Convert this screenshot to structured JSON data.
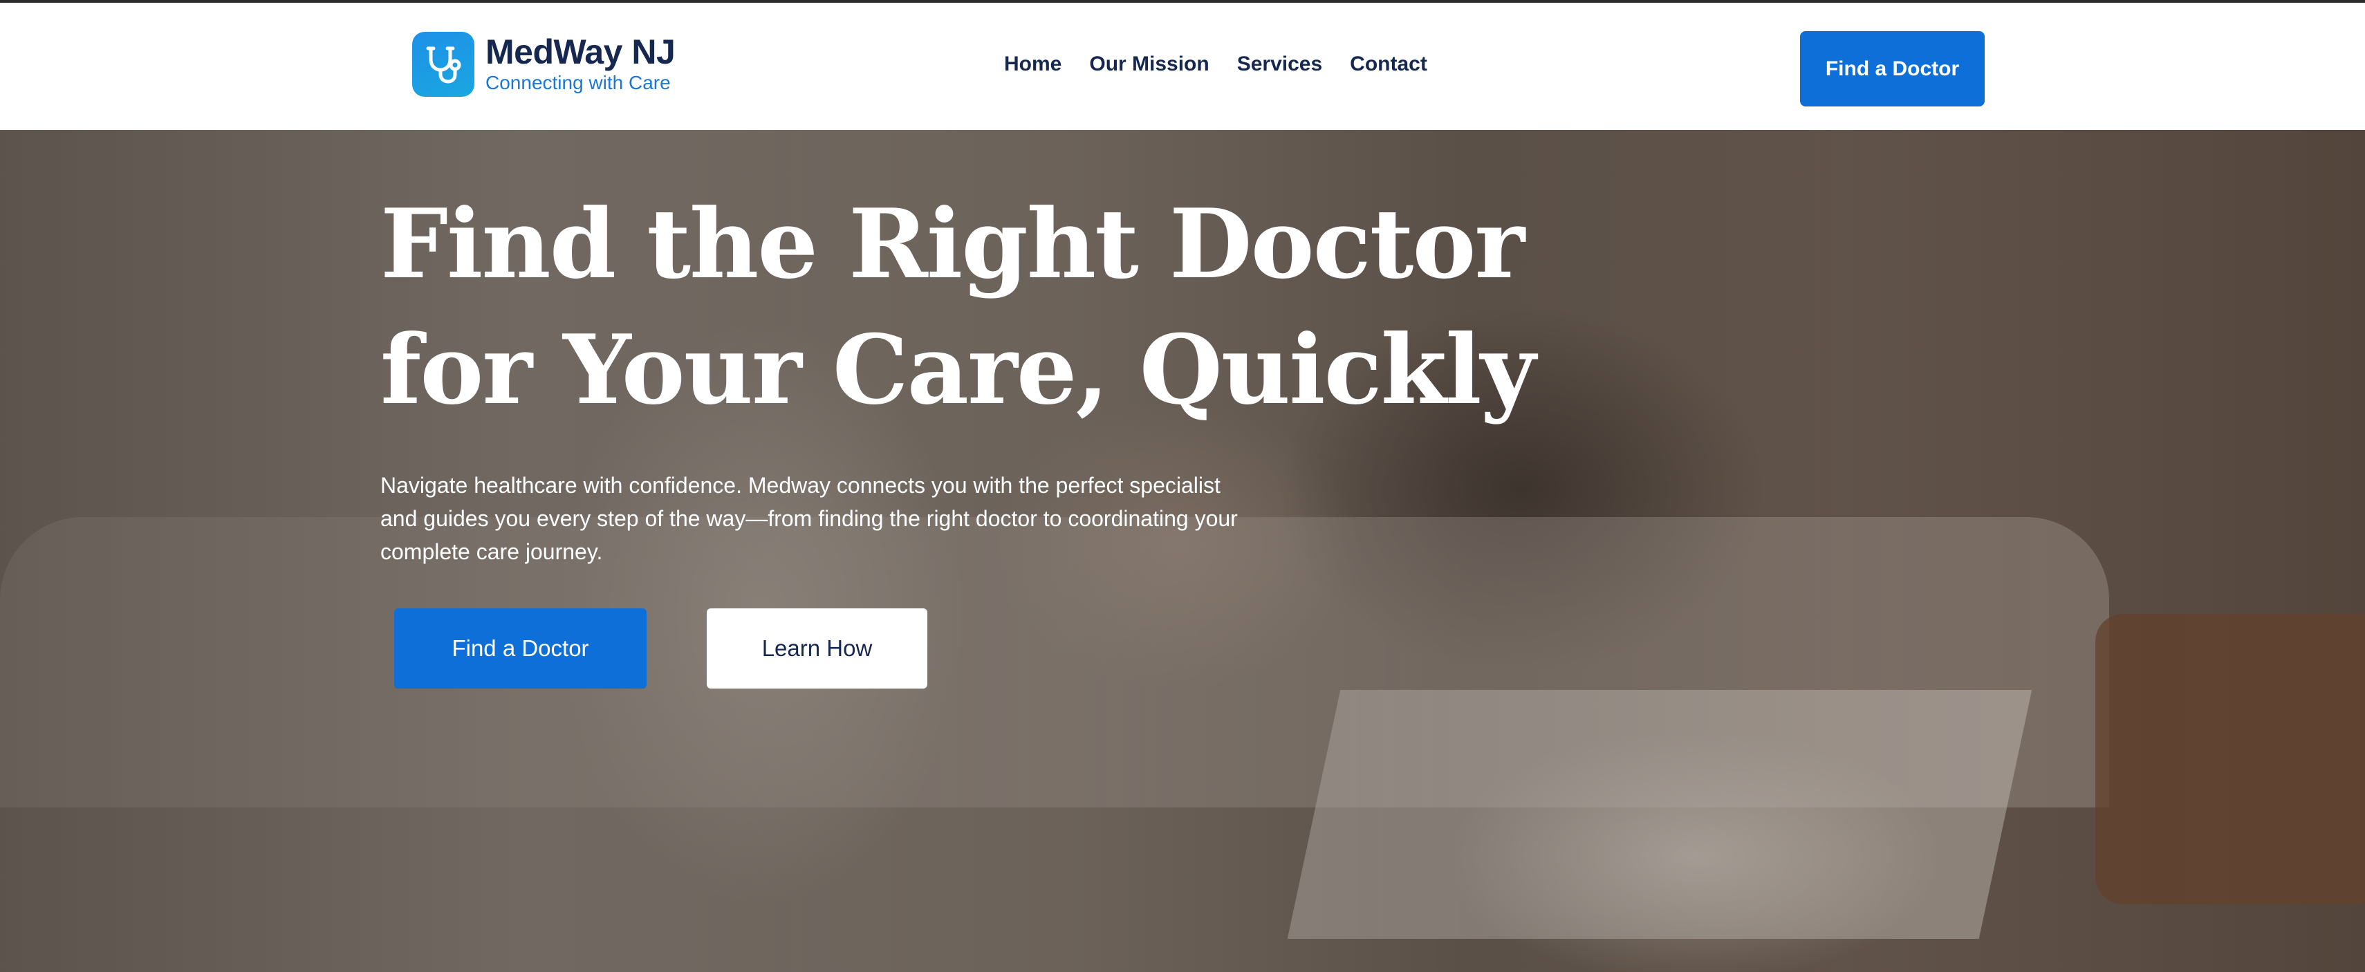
{
  "brand": {
    "name": "MedWay NJ",
    "tagline": "Connecting with Care",
    "icon": "stethoscope-icon",
    "accent_color": "#0f6fd9",
    "navy_color": "#16284f"
  },
  "nav": {
    "items": [
      {
        "label": "Home"
      },
      {
        "label": "Our Mission"
      },
      {
        "label": "Services"
      },
      {
        "label": "Contact"
      }
    ],
    "cta_label": "Find a Doctor"
  },
  "hero": {
    "title_line1": "Find the Right Doctor",
    "title_line2": "for Your Care, Quickly",
    "subtitle": "Navigate healthcare with confidence. Medway connects you with the perfect specialist and guides you every step of the way—from finding the right doctor to coordinating your complete care journey.",
    "primary_button": "Find a Doctor",
    "secondary_button": "Learn How"
  }
}
